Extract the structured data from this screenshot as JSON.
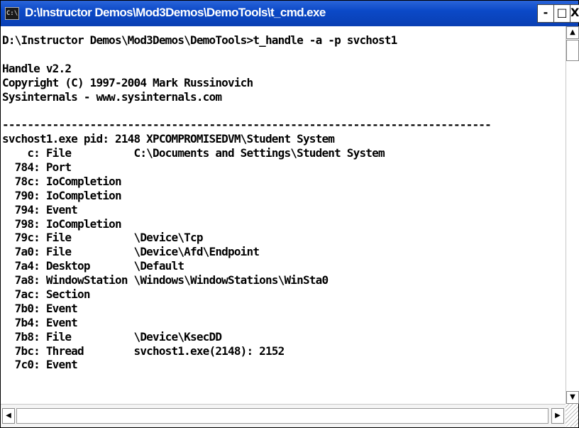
{
  "window": {
    "title": "D:\\Instructor Demos\\Mod3Demos\\DemoTools\\t_cmd.exe",
    "icon": "console-icon",
    "icon_glyph": "C:\\",
    "controls": {
      "minimize": "-",
      "maximize": "□",
      "close": "X"
    }
  },
  "console": {
    "lines": [
      "D:\\Instructor Demos\\Mod3Demos\\DemoTools>t_handle -a -p svchost1",
      "",
      "Handle v2.2",
      "Copyright (C) 1997-2004 Mark Russinovich",
      "Sysinternals - www.sysinternals.com",
      "",
      "------------------------------------------------------------------------------",
      "svchost1.exe pid: 2148 XPCOMPROMISEDVM\\Student System",
      "    c: File          C:\\Documents and Settings\\Student System",
      "  784: Port",
      "  78c: IoCompletion",
      "  790: IoCompletion",
      "  794: Event",
      "  798: IoCompletion",
      "  79c: File          \\Device\\Tcp",
      "  7a0: File          \\Device\\Afd\\Endpoint",
      "  7a4: Desktop       \\Default",
      "  7a8: WindowStation \\Windows\\WindowStations\\WinSta0",
      "  7ac: Section",
      "  7b0: Event",
      "  7b4: Event",
      "  7b8: File          \\Device\\KsecDD",
      "  7bc: Thread        svchost1.exe(2148): 2152",
      "  7c0: Event"
    ]
  },
  "scrollbars": {
    "vertical": {
      "up_arrow": "▲",
      "down_arrow": "▼"
    },
    "horizontal": {
      "left_arrow": "◀",
      "right_arrow": "▶"
    }
  }
}
